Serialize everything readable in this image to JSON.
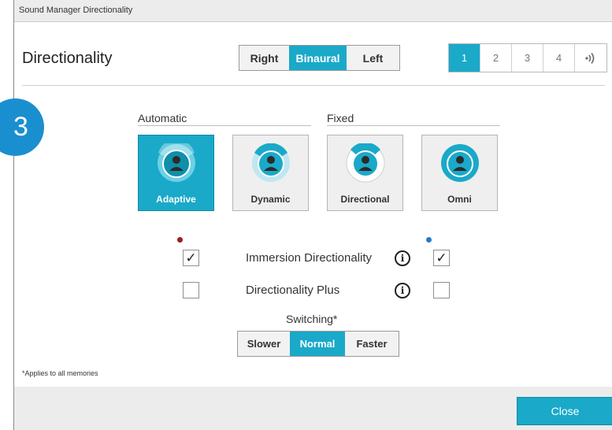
{
  "window": {
    "title": "Sound Manager Directionality"
  },
  "heading": "Directionality",
  "side_selector": {
    "options": [
      "Right",
      "Binaural",
      "Left"
    ],
    "selected": "Binaural"
  },
  "memory_selector": {
    "options": [
      "1",
      "2",
      "3",
      "4"
    ],
    "selected": "1",
    "extra_icon": "wireless-streaming-icon"
  },
  "step_badge": "3",
  "groups": {
    "automatic": "Automatic",
    "fixed": "Fixed"
  },
  "modes": [
    {
      "label": "Adaptive",
      "selected": true,
      "icon": "adaptive-mode-icon"
    },
    {
      "label": "Dynamic",
      "selected": false,
      "icon": "dynamic-mode-icon"
    },
    {
      "label": "Directional",
      "selected": false,
      "icon": "directional-mode-icon"
    },
    {
      "label": "Omni",
      "selected": false,
      "icon": "omni-mode-icon"
    }
  ],
  "ear_markers": {
    "left_color": "#a01c1c",
    "right_color": "#2a78c8"
  },
  "options": [
    {
      "label": "Immersion Directionality",
      "left_checked": true,
      "right_checked": true,
      "info_icon": "i"
    },
    {
      "label": "Directionality Plus",
      "left_checked": false,
      "right_checked": false,
      "info_icon": "i"
    }
  ],
  "switching": {
    "label": "Switching*",
    "options": [
      "Slower",
      "Normal",
      "Faster"
    ],
    "selected": "Normal"
  },
  "footnote": "*Applies to all memories",
  "close_button": "Close",
  "colors": {
    "accent": "#1aa9c9",
    "badge": "#1a8fd0"
  }
}
